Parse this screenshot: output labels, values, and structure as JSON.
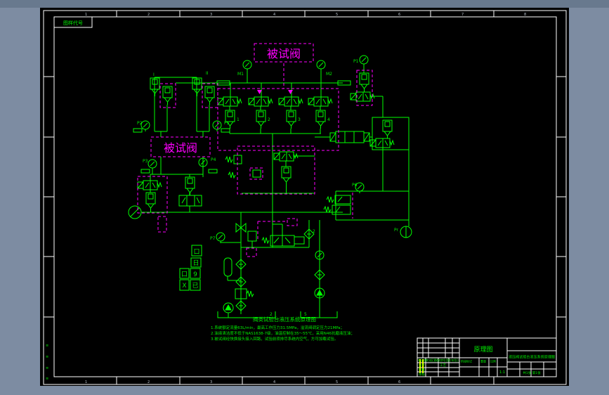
{
  "window": {
    "surround_color": "#7d8ca2",
    "topbar_color": "#68798e",
    "canvas_color": "#000000"
  },
  "colors": {
    "line": "#00ff00",
    "highlight": "#ff00ff",
    "frame": "#ffffff",
    "revision": "#ffff00"
  },
  "frame": {
    "corner_label": "图样代号",
    "zones_top": [
      "1",
      "2",
      "3",
      "4",
      "5",
      "6",
      "7",
      "8"
    ],
    "margin_marks": [
      "≡",
      "≡",
      "≡",
      "≡"
    ]
  },
  "schematic": {
    "test_valve_label_1": "被试阀",
    "test_valve_label_2": "被试阀",
    "caption": "阀类试验台液压系统原理图",
    "notes": [
      "1.系统额定流量63L/min，最高工作压力31.5MPa，溢流阀调定压力21MPa；",
      "2.油液清洁度不低于NAS1638-7级，油温控制在35～55℃，采用N46抗磨液压油；",
      "3.被试阀经快换接头接入回路，试验前须排尽系统内空气，方可加载试验。"
    ],
    "legend_glyphs": [
      "口",
      "日",
      "口",
      "9",
      "X",
      "已"
    ],
    "labels": [
      {
        "text": "M1"
      },
      {
        "text": "M2"
      },
      {
        "text": "I"
      },
      {
        "text": "II"
      },
      {
        "text": "P2"
      },
      {
        "text": "P5"
      },
      {
        "text": "P3"
      },
      {
        "text": "P4"
      },
      {
        "text": "1"
      },
      {
        "text": "2"
      },
      {
        "text": "3"
      },
      {
        "text": "4"
      },
      {
        "text": "P1"
      },
      {
        "text": "P6"
      },
      {
        "text": "Pr"
      },
      {
        "text": "P7"
      },
      {
        "text": "2"
      },
      {
        "text": "5"
      },
      {
        "text": "2"
      }
    ]
  },
  "title_block": {
    "main_title": "原理图",
    "product_name": "液压阀试验台液压系统原理图",
    "columns_header": "标记 处数 分区 更改文件号 签名 年月日",
    "row_labels": [
      "设计",
      "校核",
      "审核",
      "工艺"
    ],
    "stage_labels": [
      "阶段标记",
      "重量",
      "比例"
    ],
    "scale_value": "1:1",
    "sheet_info": "共1张 第1张"
  }
}
